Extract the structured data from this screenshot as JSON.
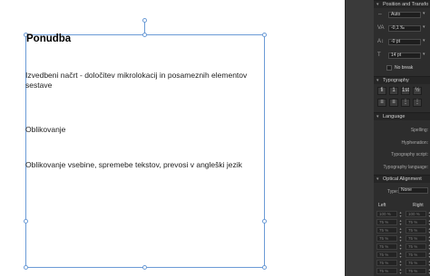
{
  "document": {
    "title": "Ponudba",
    "paragraphs": [
      "Izvedbeni načrt - določitev mikrolokacij in posameznih elementov sestave",
      "Oblikovanje",
      "Oblikovanje vsebine, spremebe tekstov, prevosi v angleški jezik"
    ]
  },
  "panel": {
    "position_section": {
      "title": "Position and Transfo",
      "tracking": "Auto",
      "kerning": "-0,1 ‰",
      "baseline": "-0 pt",
      "size": "14 pt",
      "no_break_label": "No break"
    },
    "typography_section": {
      "title": "Typography",
      "buttons": [
        "fi",
        "1",
        "1st",
        "½"
      ]
    },
    "language_section": {
      "title": "Language",
      "spelling_label": "Spelling:",
      "hyphenation_label": "Hyphenation:",
      "typography_script_label": "Typography script:",
      "typography_language_label": "Typography language:"
    },
    "optical_section": {
      "title": "Optical Alignment",
      "type_label": "Type:",
      "type_value": "None",
      "left_label": "Left",
      "right_label": "Right",
      "left_values": [
        "100 %",
        "75 %",
        "75 %",
        "75 %",
        "75 %",
        "75 %",
        "75 %",
        "75 %"
      ],
      "right_values": [
        "100 %",
        "75 %",
        "75 %",
        "75 %",
        "75 %",
        "75 %",
        "75 %",
        "75 %"
      ]
    }
  }
}
